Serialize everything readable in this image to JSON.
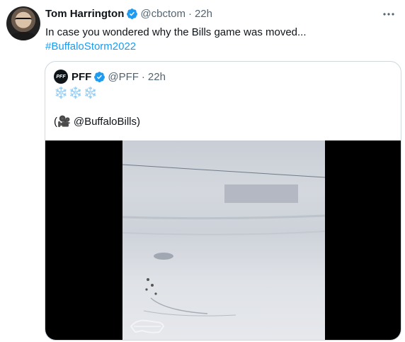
{
  "tweet": {
    "author_name": "Tom Harrington",
    "author_handle": "@cbctom",
    "separator": "·",
    "time": "22h",
    "text": "In case you wondered why the Bills game was moved...",
    "hashtag": "#BuffaloStorm2022"
  },
  "quoted": {
    "logo_text": "PFF",
    "author_name": "PFF",
    "author_handle": "@PFF",
    "separator": "·",
    "time": "22h",
    "line1": "❄️❄️❄️",
    "line2": "(🎥 @BuffaloBills)"
  },
  "colors": {
    "accent": "#1d9bf0",
    "secondary_text": "#536471",
    "border": "#cfd9de"
  },
  "icons": [
    "verified-badge-icon",
    "more-options-icon",
    "buffalo-bills-logo"
  ]
}
